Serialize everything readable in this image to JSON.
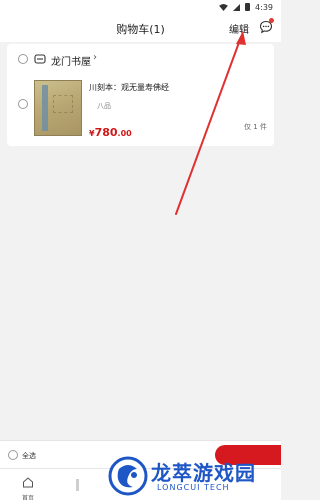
{
  "status_bar": {
    "time": "4:39"
  },
  "header": {
    "title": "购物车(1)",
    "edit_label": "编辑"
  },
  "shop": {
    "name": "龙门书屋"
  },
  "product": {
    "name": "川刻本：观无量寿佛经",
    "condition": "八品",
    "price_currency": "¥",
    "price_int": "780",
    "price_dec": ".00",
    "quantity_text": "仅 1 件"
  },
  "footer": {
    "select_all_label": "全选"
  },
  "tabs": {
    "home_label": "首页"
  },
  "watermark": {
    "text": "龙萃游戏园",
    "sub": "LONGCUI TECH"
  },
  "colors": {
    "accent": "#d6191f",
    "price": "#d01818",
    "arrow": "#e03030",
    "watermark": "#1e56c6"
  }
}
